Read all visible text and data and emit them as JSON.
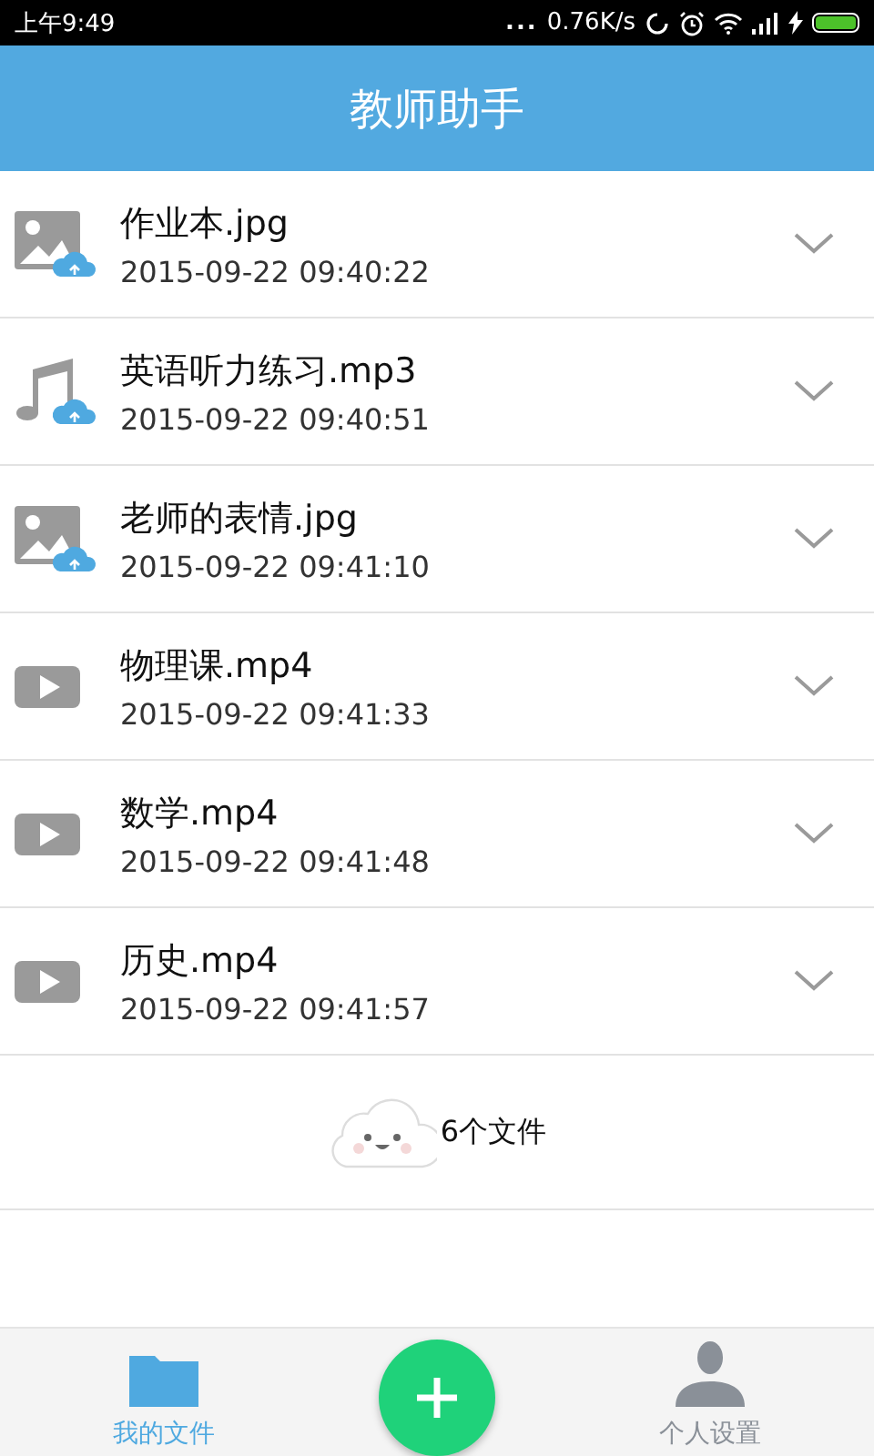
{
  "status_bar": {
    "time": "上午9:49",
    "dots": "...",
    "speed": "0.76K/s"
  },
  "header": {
    "title": "教师助手"
  },
  "files": [
    {
      "name": "作业本.jpg",
      "time": "2015-09-22 09:40:22",
      "kind": "image",
      "uploading": true
    },
    {
      "name": "英语听力练习.mp3",
      "time": "2015-09-22 09:40:51",
      "kind": "audio",
      "uploading": true
    },
    {
      "name": "老师的表情.jpg",
      "time": "2015-09-22 09:41:10",
      "kind": "image",
      "uploading": true
    },
    {
      "name": "物理课.mp4",
      "time": "2015-09-22 09:41:33",
      "kind": "video",
      "uploading": false
    },
    {
      "name": "数学.mp4",
      "time": "2015-09-22 09:41:48",
      "kind": "video",
      "uploading": false
    },
    {
      "name": "历史.mp4",
      "time": "2015-09-22 09:41:57",
      "kind": "video",
      "uploading": false
    }
  ],
  "footer": {
    "count": "6个文件"
  },
  "tabs": [
    {
      "label": "我的文件",
      "kind": "files",
      "selected": true
    },
    {
      "label": "个人设置",
      "kind": "profile",
      "selected": false
    }
  ]
}
